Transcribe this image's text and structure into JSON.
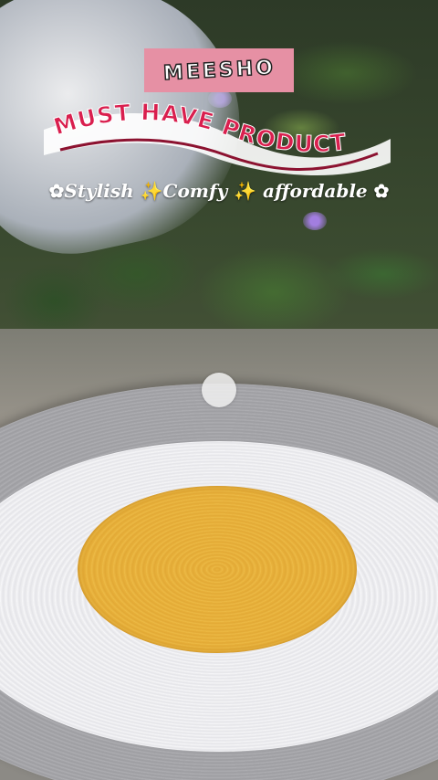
{
  "brand": {
    "text": "MEESHO",
    "bg_color": "#e690a4"
  },
  "banner": {
    "text": "MUST HAVE PRODUCT",
    "text_color": "#d91f4e",
    "stroke_color": "#ffffff"
  },
  "tagline": {
    "parts": [
      "Stylish ",
      "Comfy ",
      " affordable "
    ],
    "flower_glyph": "✿",
    "sparkle_glyph": "✨"
  },
  "icons": {
    "flower": "flower-icon",
    "sparkle": "sparkle-icon"
  },
  "colors": {
    "mat_yellow": "#e9b33d",
    "mat_white": "#f1f1f3",
    "mat_grey": "#a7a7ab"
  }
}
